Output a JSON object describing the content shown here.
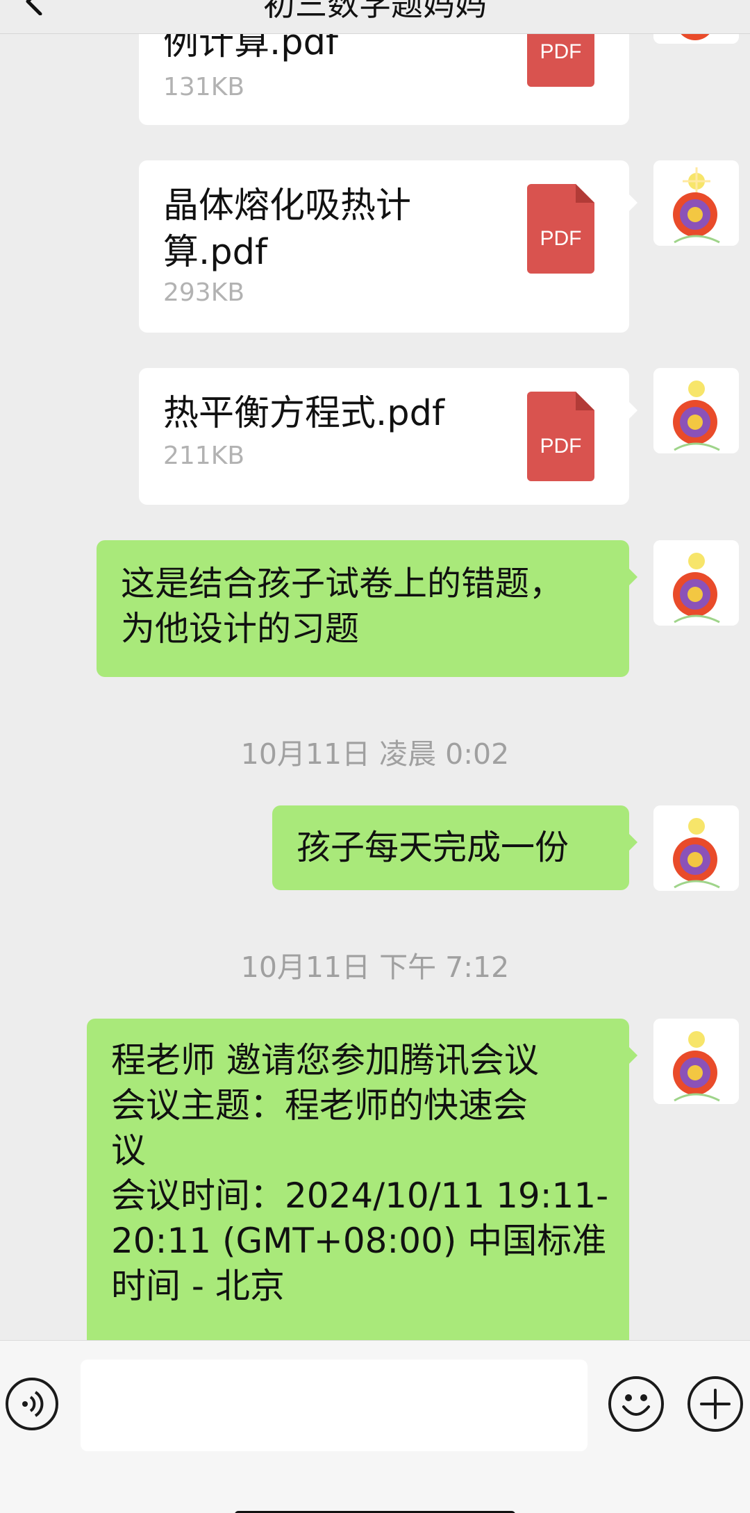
{
  "header": {
    "title": "初三数学题妈妈"
  },
  "messages": [
    {
      "type": "file",
      "name": "例计算.pdf",
      "size": "131KB",
      "icon": "pdf-icon",
      "icon_label": "PDF"
    },
    {
      "type": "file",
      "name": "晶体熔化吸热计算.pdf",
      "size": "293KB",
      "icon": "pdf-icon",
      "icon_label": "PDF"
    },
    {
      "type": "file",
      "name": "热平衡方程式.pdf",
      "size": "211KB",
      "icon": "pdf-icon",
      "icon_label": "PDF"
    },
    {
      "type": "text",
      "lines": [
        "这是结合孩子试卷上的错题，",
        "为他设计的习题"
      ]
    },
    {
      "type": "time",
      "text": "10月11日 凌晨 0:02"
    },
    {
      "type": "text",
      "lines": [
        "孩子每天完成一份"
      ]
    },
    {
      "type": "time",
      "text": "10月11日 下午 7:12"
    },
    {
      "type": "text",
      "lines": [
        "程老师 邀请您参加腾讯会议",
        "会议主题：程老师的快速会",
        "议",
        "会议时间：2024/10/11 19:11-",
        "20:11 (GMT+08:00) 中国标准",
        "时间 - 北京"
      ]
    }
  ],
  "input_bar": {
    "voice_icon": "voice-icon",
    "text_value": "",
    "emoji_icon": "emoji-icon",
    "plus_icon": "plus-icon"
  },
  "colors": {
    "background": "#ededed",
    "sent_bubble": "#a9e97a",
    "file_card": "#ffffff",
    "pdf_red": "#d9534f",
    "timestamp_text": "#a0a0a0"
  }
}
